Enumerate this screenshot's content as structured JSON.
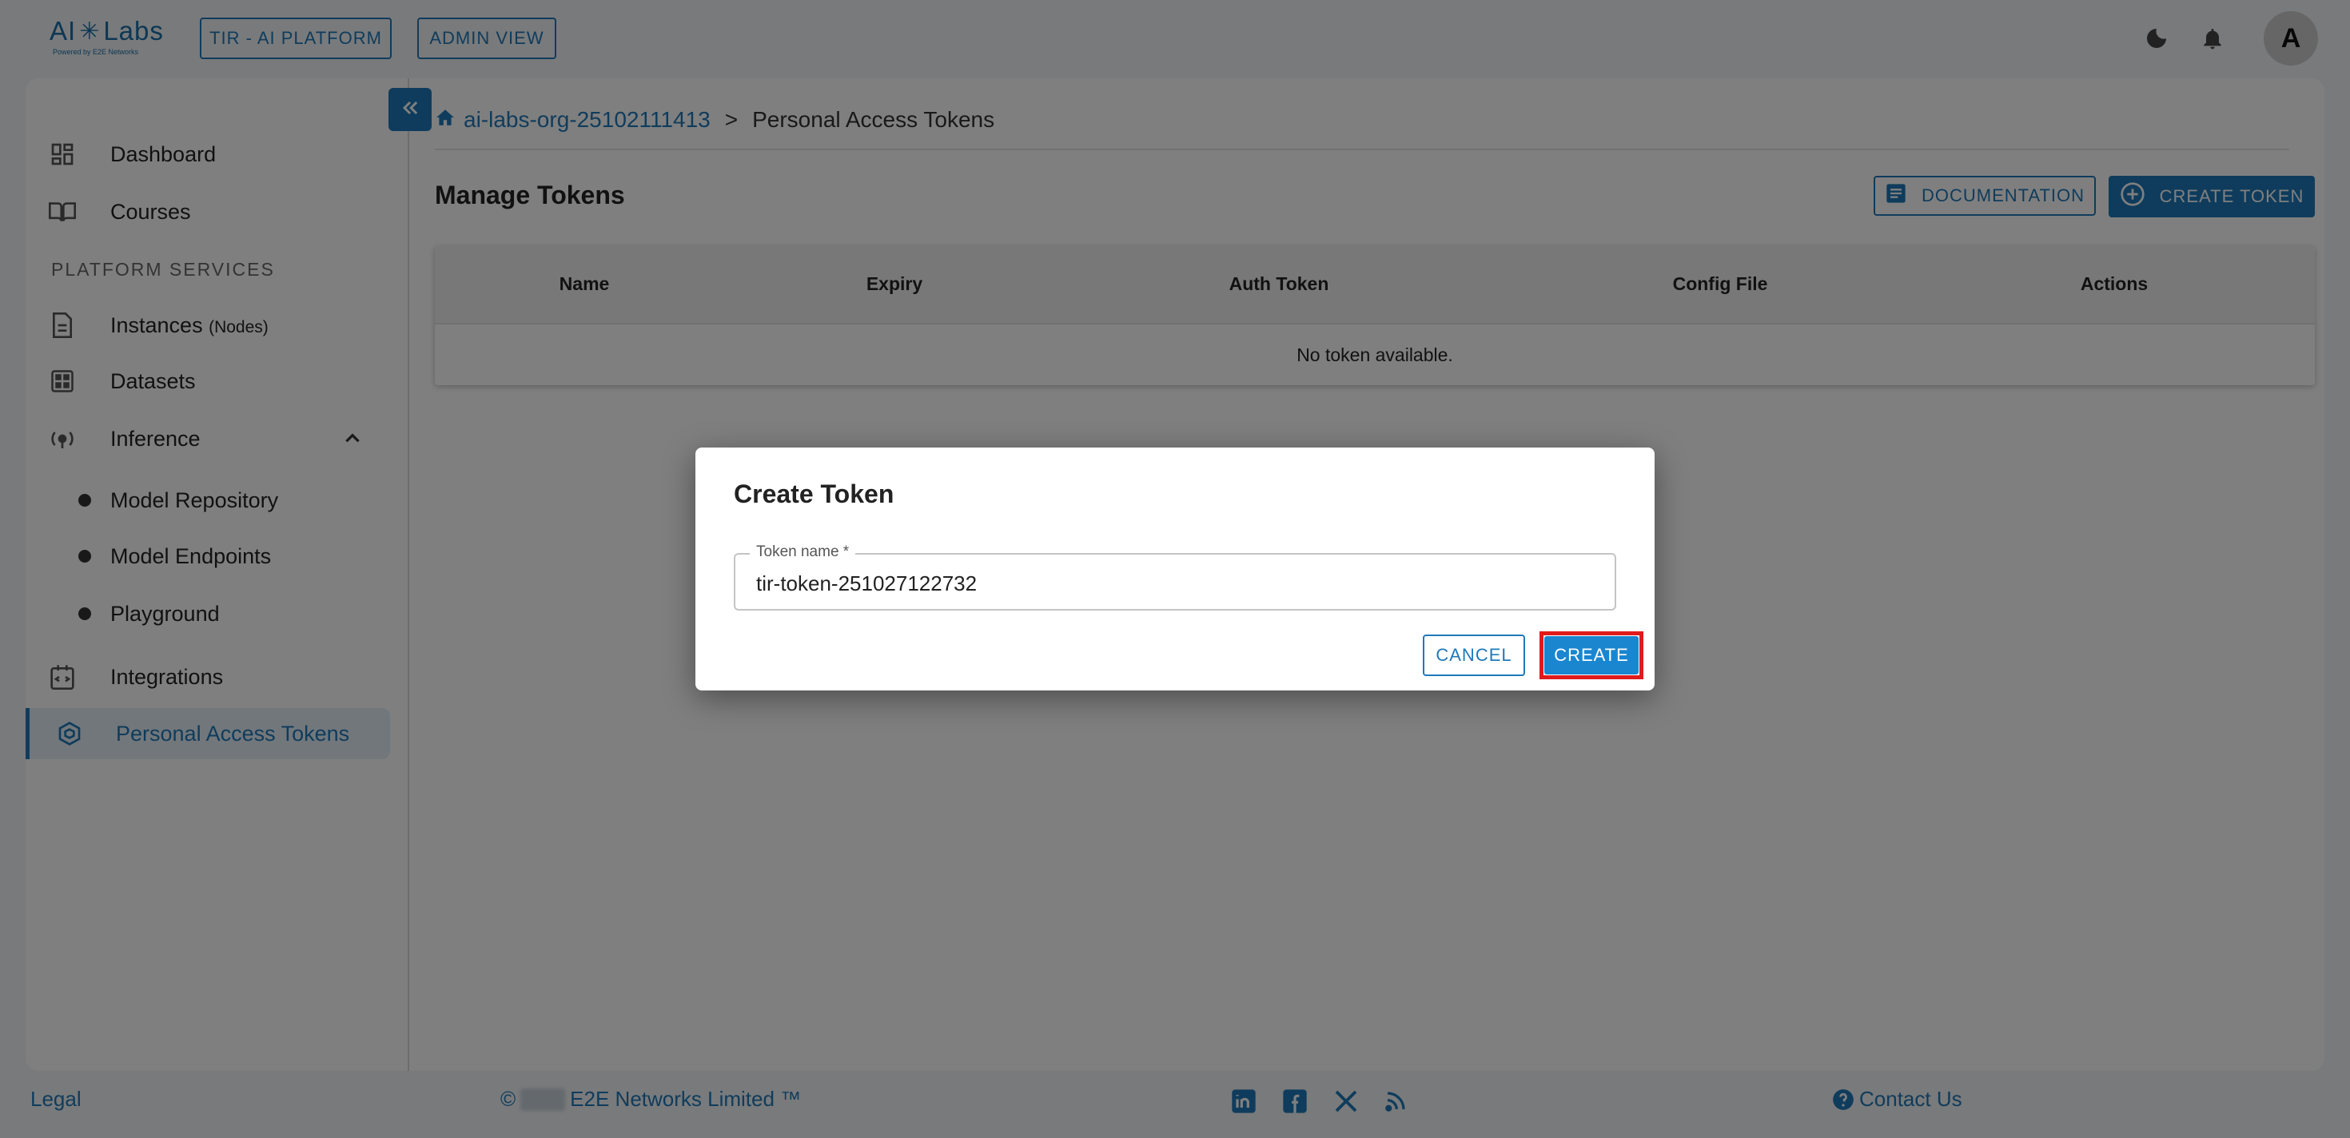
{
  "brand": {
    "name_part1": "AI",
    "name_part2": "Labs",
    "tagline": "Powered by E2E Networks"
  },
  "topbar": {
    "platform_button": "TIR - AI PLATFORM",
    "admin_button": "ADMIN VIEW",
    "avatar_initial": "A"
  },
  "sidebar": {
    "dashboard": "Dashboard",
    "courses": "Courses",
    "section_header": "PLATFORM SERVICES",
    "instances": "Instances",
    "instances_suffix": "(Nodes)",
    "datasets": "Datasets",
    "inference": "Inference",
    "model_repository": "Model Repository",
    "model_endpoints": "Model Endpoints",
    "playground": "Playground",
    "integrations": "Integrations",
    "personal_access_tokens": "Personal Access Tokens"
  },
  "breadcrumb": {
    "org": "ai-labs-org-25102111413",
    "separator": ">",
    "current": "Personal Access Tokens"
  },
  "page": {
    "title": "Manage Tokens",
    "documentation_button": "DOCUMENTATION",
    "create_token_button": "CREATE TOKEN"
  },
  "table": {
    "columns": [
      "Name",
      "Expiry",
      "Auth Token",
      "Config File",
      "Actions"
    ],
    "empty_message": "No token available."
  },
  "dialog": {
    "title": "Create Token",
    "field_label": "Token name *",
    "field_value": "tir-token-251027122732",
    "cancel_button": "CANCEL",
    "create_button": "CREATE"
  },
  "footer": {
    "legal": "Legal",
    "copyright_symbol": "©",
    "company": "E2E Networks Limited ™",
    "contact": "Contact Us"
  },
  "colors": {
    "accent": "#1f79b8",
    "highlight": "#e01b1b"
  }
}
